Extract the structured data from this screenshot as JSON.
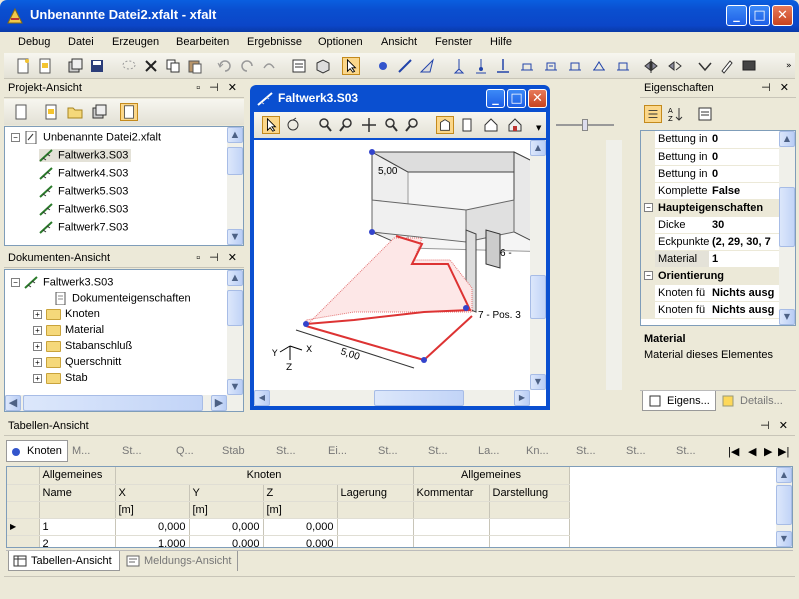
{
  "window": {
    "title": "Unbenannte Datei2.xfalt - xfalt",
    "min": "_",
    "max": "□",
    "close": "✕"
  },
  "menu": [
    "Debug",
    "Datei",
    "Erzeugen",
    "Bearbeiten",
    "Ergebnisse",
    "Optionen",
    "Ansicht",
    "Fenster",
    "Hilfe"
  ],
  "project": {
    "title": "Projekt-Ansicht",
    "controls": "▫ ⊣ ✕",
    "root": "Unbenannte Datei2.xfalt",
    "items": [
      "Faltwerk3.S03",
      "Faltwerk4.S03",
      "Faltwerk5.S03",
      "Faltwerk6.S03",
      "Faltwerk7.S03"
    ]
  },
  "documents": {
    "title": "Dokumenten-Ansicht",
    "controls": "▫ ⊣ ✕",
    "root": "Faltwerk3.S03",
    "props": "Dokumenteigenschaften",
    "folders": [
      "Knoten",
      "Material",
      "Stabanschluß",
      "Querschnitt",
      "Stab"
    ]
  },
  "child": {
    "title": "Faltwerk3.S03",
    "labels": {
      "dim1": "5,00",
      "node6": "6 -",
      "node7": "7 - Pos. 3",
      "dim2": "5,00",
      "ax_x": "X",
      "ax_y": "Y",
      "ax_z": "Z"
    }
  },
  "properties": {
    "title": "Eigenschaften",
    "controls": "⊣ ✕",
    "rows": [
      {
        "k": "Bettung in",
        "v": "0"
      },
      {
        "k": "Bettung in",
        "v": "0"
      },
      {
        "k": "Bettung in",
        "v": "0"
      },
      {
        "k": "Komplette",
        "v": "False"
      }
    ],
    "group1": "Haupteigenschaften",
    "rows2": [
      {
        "k": "Dicke",
        "v": "30"
      },
      {
        "k": "Eckpunkte",
        "v": "(2, 29, 30, 7"
      },
      {
        "k": "Material",
        "v": "1"
      }
    ],
    "group2": "Orientierung",
    "rows3": [
      {
        "k": "Knoten fü",
        "v": "Nichts ausg"
      },
      {
        "k": "Knoten fü",
        "v": "Nichts ausg"
      }
    ],
    "desc_title": "Material",
    "desc_text": "Material dieses Elementes",
    "tab1": "Eigens...",
    "tab2": "Details..."
  },
  "table": {
    "title": "Tabellen-Ansicht",
    "controls": "⊣ ✕",
    "tabs": [
      "Knoten",
      "M...",
      "St...",
      "Q...",
      "Stab",
      "St...",
      "Ei...",
      "St...",
      "St...",
      "La...",
      "Kn...",
      "St...",
      "St...",
      "St..."
    ],
    "nav": [
      "|◀",
      "◀",
      "▶",
      "▶|"
    ],
    "group_h": [
      "Allgemeines",
      "Knoten",
      "Allgemeines"
    ],
    "cols": [
      "Name",
      "X",
      "Y",
      "Z",
      "Lagerung",
      "Kommentar",
      "Darstellung"
    ],
    "units": [
      "",
      "[m]",
      "[m]",
      "[m]",
      "",
      "",
      ""
    ],
    "rows": [
      {
        "marker": "▶",
        "name": "1",
        "x": "0,000",
        "y": "0,000",
        "z": "0,000"
      },
      {
        "marker": "",
        "name": "2",
        "x": "1.000",
        "y": "0,000",
        "z": "0,000"
      }
    ]
  },
  "bottomtabs": [
    "Tabellen-Ansicht",
    "Meldungs-Ansicht"
  ]
}
